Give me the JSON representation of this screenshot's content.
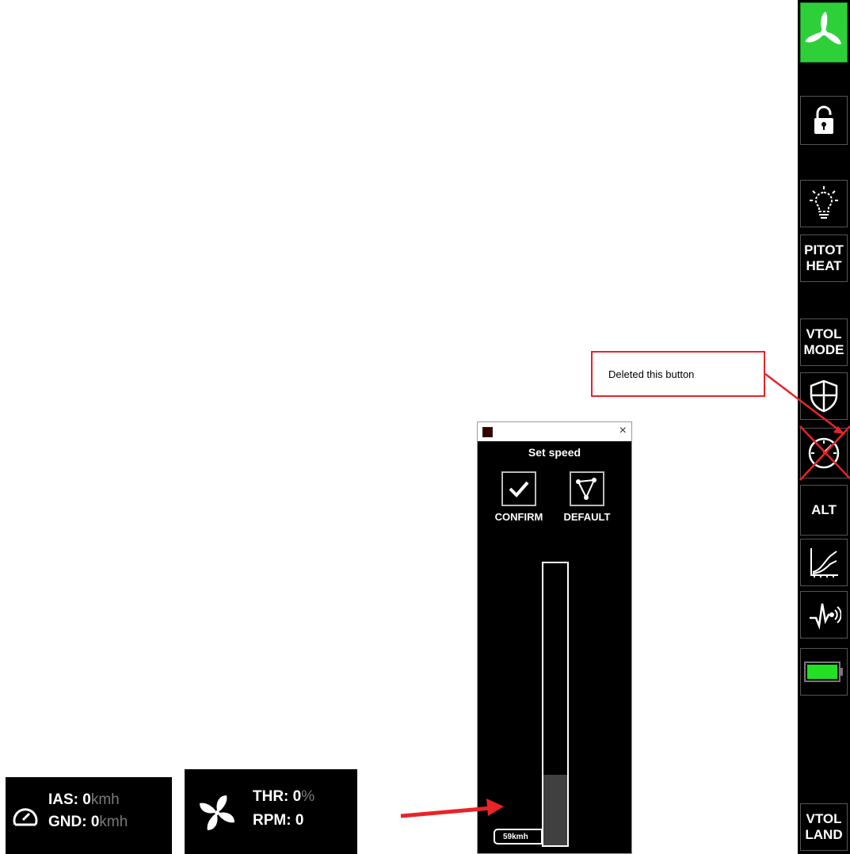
{
  "sidebar": {
    "buttons": [
      {
        "name": "propeller-button",
        "icon": "propeller-icon",
        "label": ""
      },
      {
        "name": "lock-button",
        "icon": "lock-open-icon",
        "label": ""
      },
      {
        "name": "lights-button",
        "icon": "lightbulb-icon",
        "label": ""
      },
      {
        "name": "pitot-heat-button",
        "icon": "",
        "label": "PITOT\nHEAT"
      },
      {
        "name": "vtol-mode-button",
        "icon": "",
        "label": "VTOL\nMODE"
      },
      {
        "name": "geofence-button",
        "icon": "shield-icon",
        "label": ""
      },
      {
        "name": "speed-button",
        "icon": "speedometer-icon",
        "label": ""
      },
      {
        "name": "alt-button",
        "icon": "",
        "label": "ALT"
      },
      {
        "name": "graph-button",
        "icon": "chart-icon",
        "label": ""
      },
      {
        "name": "signal-button",
        "icon": "pulse-signal-icon",
        "label": ""
      },
      {
        "name": "battery-button",
        "icon": "battery-icon",
        "label": ""
      },
      {
        "name": "vtol-land-button",
        "icon": "",
        "label": "VTOL\nLAND"
      }
    ],
    "active_color": "#2ed03a",
    "battery_color": "#22e022"
  },
  "dialog": {
    "title": "Set speed",
    "close_glyph": "×",
    "confirm_label": "CONFIRM",
    "default_label": "DEFAULT",
    "slider_fill_fraction": 0.25,
    "speed_value": "59kmh"
  },
  "annotation": {
    "text": "Deleted this button",
    "color": "#e8232a"
  },
  "ias_widget": {
    "ias_label": "IAS: ",
    "ias_value": "0",
    "ias_unit": "kmh",
    "gnd_label": "GND: ",
    "gnd_value": "0",
    "gnd_unit": "kmh"
  },
  "thr_widget": {
    "thr_label": "THR: ",
    "thr_value": "0",
    "thr_unit": "%",
    "rpm_label": "RPM: ",
    "rpm_value": "0"
  }
}
